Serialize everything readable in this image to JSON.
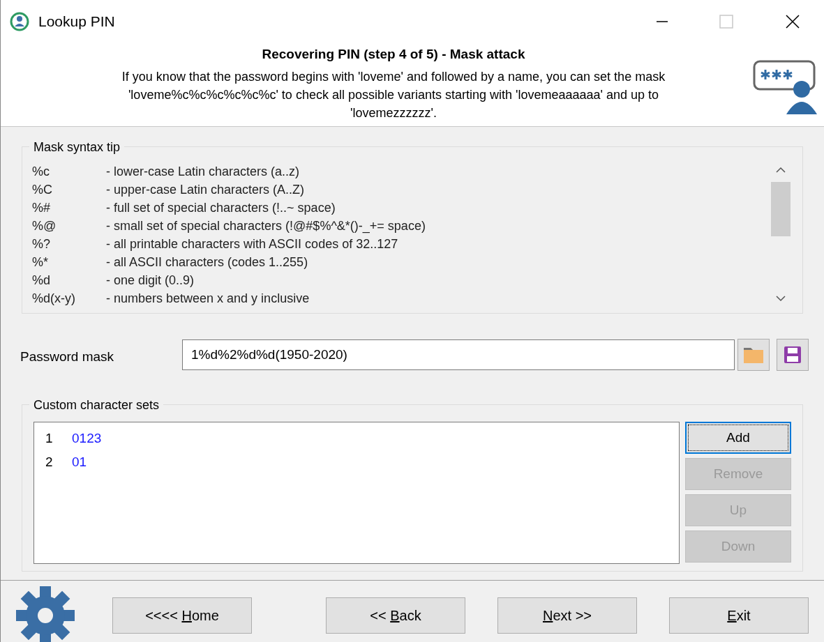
{
  "window": {
    "title": "Lookup PIN"
  },
  "header": {
    "title": "Recovering PIN (step 4 of 5) - Mask attack",
    "description": "If you know that the password begins with 'loveme' and followed by a name, you can set the mask 'loveme%c%c%c%c%c%c' to check all possible variants starting with 'lovemeaaaaaa' and up to 'lovemezzzzzz'."
  },
  "mask_tip": {
    "title": "Mask syntax tip",
    "rows": [
      {
        "code": "%c",
        "meaning": "- lower-case Latin characters  (a..z)"
      },
      {
        "code": "%C",
        "meaning": "- upper-case Latin characters (A..Z)"
      },
      {
        "code": "%#",
        "meaning": "- full set of special characters (!..~ space)"
      },
      {
        "code": "%@",
        "meaning": "- small set of special characters (!@#$%^&*()-_+= space)"
      },
      {
        "code": "%?",
        "meaning": "- all printable characters with ASCII codes of 32..127"
      },
      {
        "code": "%*",
        "meaning": "- all ASCII characters (codes 1..255)"
      },
      {
        "code": "%d",
        "meaning": "- one digit (0..9)"
      },
      {
        "code": "%d(x-y)",
        "meaning": "- numbers between x and y inclusive"
      }
    ]
  },
  "password_mask": {
    "label": "Password mask",
    "value": "1%d%2%d%d(1950-2020)"
  },
  "custom_sets": {
    "title": "Custom character sets",
    "items": [
      {
        "number": "1",
        "value": "0123"
      },
      {
        "number": "2",
        "value": "01"
      }
    ],
    "buttons": [
      {
        "label": "Add",
        "disabled": false,
        "focused": true
      },
      {
        "label": "Remove",
        "disabled": true,
        "focused": false
      },
      {
        "label": "Up",
        "disabled": true,
        "focused": false
      },
      {
        "label": "Down",
        "disabled": true,
        "focused": false
      }
    ]
  },
  "footer_buttons": [
    {
      "before": "<<<< ",
      "key": "H",
      "after": "ome"
    },
    {
      "before": "<< ",
      "key": "B",
      "after": "ack"
    },
    {
      "key": "N",
      "after": "ext >>"
    },
    {
      "key": "E",
      "after": "xit"
    }
  ]
}
